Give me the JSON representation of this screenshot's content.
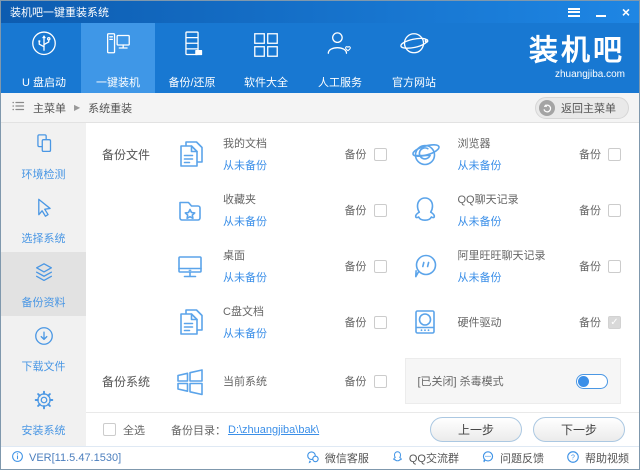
{
  "colors": {
    "titlebar": "#1374d0",
    "nav": "#1878d2",
    "nav_selected": "#3f97e7",
    "accent": "#5ba4ea",
    "link": "#3b8fe8",
    "sidebar_bg": "#f1f1f1"
  },
  "titlebar": {
    "title": "装机吧一键重装系统"
  },
  "nav": {
    "items": [
      {
        "label": "U 盘启动",
        "icon": "usb-boot-icon",
        "selected": false
      },
      {
        "label": "一键装机",
        "icon": "one-key-install-icon",
        "selected": true
      },
      {
        "label": "备份/还原",
        "icon": "backup-restore-icon",
        "selected": false
      },
      {
        "label": "软件大全",
        "icon": "software-grid-icon",
        "selected": false
      },
      {
        "label": "人工服务",
        "icon": "customer-service-icon",
        "selected": false
      },
      {
        "label": "官方网站",
        "icon": "official-site-icon",
        "selected": false
      }
    ],
    "logo": {
      "text": "装机吧",
      "domain": "zhuangjiba.com"
    }
  },
  "breadcrumb": {
    "root": "主菜单",
    "separator": "▶",
    "current": "系统重装",
    "back_button": "返回主菜单"
  },
  "sidebar": {
    "items": [
      {
        "label": "环境检测",
        "icon": "env-check-icon",
        "selected": false
      },
      {
        "label": "选择系统",
        "icon": "select-system-icon",
        "selected": false
      },
      {
        "label": "备份资料",
        "icon": "backup-data-icon",
        "selected": true
      },
      {
        "label": "下载文件",
        "icon": "download-files-icon",
        "selected": false
      },
      {
        "label": "安装系统",
        "icon": "install-system-icon",
        "selected": false
      }
    ]
  },
  "main": {
    "files_section_label": "备份文件",
    "system_section_label": "备份系统",
    "backup_label": "备份",
    "items": [
      {
        "title": "我的文档",
        "status": "从未备份",
        "icon": "my-documents-icon",
        "checked": false
      },
      {
        "title": "浏览器",
        "status": "从未备份",
        "icon": "browser-icon",
        "checked": false
      },
      {
        "title": "收藏夹",
        "status": "从未备份",
        "icon": "favorites-folder-icon",
        "checked": false
      },
      {
        "title": "QQ聊天记录",
        "status": "从未备份",
        "icon": "qq-chat-icon",
        "checked": false
      },
      {
        "title": "桌面",
        "status": "从未备份",
        "icon": "desktop-icon",
        "checked": false
      },
      {
        "title": "阿里旺旺聊天记录",
        "status": "从未备份",
        "icon": "aliwangwang-chat-icon",
        "checked": false
      },
      {
        "title": "C盘文档",
        "status": "从未备份",
        "icon": "c-drive-docs-icon",
        "checked": false
      },
      {
        "title": "硬件驱动",
        "status": "",
        "icon": "hardware-driver-icon",
        "checked": true,
        "disabled": true
      }
    ],
    "system_item": {
      "title": "当前系统",
      "icon": "windows-icon",
      "checked": false
    },
    "antivirus": {
      "label": "[已关闭] 杀毒模式",
      "state": "off"
    }
  },
  "footer": {
    "select_all": "全选",
    "dir_label": "备份目录：",
    "dir_path": "D:\\zhuangjiba\\bak\\",
    "prev": "上一步",
    "next": "下一步"
  },
  "statusbar": {
    "version": "VER[11.5.47.1530]",
    "links": [
      {
        "label": "微信客服",
        "icon": "wechat-icon"
      },
      {
        "label": "QQ交流群",
        "icon": "qq-icon"
      },
      {
        "label": "问题反馈",
        "icon": "feedback-icon"
      },
      {
        "label": "帮助视频",
        "icon": "help-video-icon"
      }
    ]
  }
}
